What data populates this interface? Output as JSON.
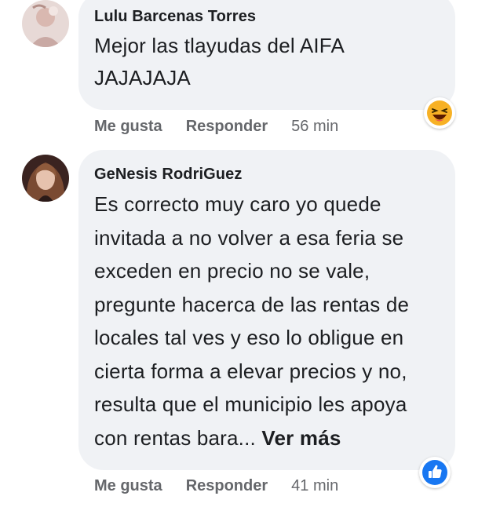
{
  "comments": [
    {
      "author": "Lulu Barcenas Torres",
      "text_lines": [
        "Mejor las tlayudas del AIFA",
        "JAJAJAJA"
      ],
      "reaction_icon": "haha-emoji-icon",
      "like_label": "Me gusta",
      "reply_label": "Responder",
      "time": "56 min"
    },
    {
      "author": "GeNesis RodriGuez",
      "text_lines": [
        "Es correcto muy caro yo quede",
        "invitada a no volver a esa feria se",
        "exceden en precio no se vale,",
        "pregunte hacerca de las rentas de",
        "locales tal ves y eso lo obligue en",
        "cierta forma a elevar precios y no,",
        "resulta que el municipio les apoya",
        "con rentas bara..."
      ],
      "see_more": "Ver más",
      "reaction_icon": "like-thumb-icon",
      "like_label": "Me gusta",
      "reply_label": "Responder",
      "time": "41 min"
    }
  ],
  "colors": {
    "bubble": "#f0f2f5",
    "text": "#1c1e21",
    "secondary": "#65676b",
    "like_blue": "#1877f2",
    "haha_yellow": "#f7b125"
  }
}
